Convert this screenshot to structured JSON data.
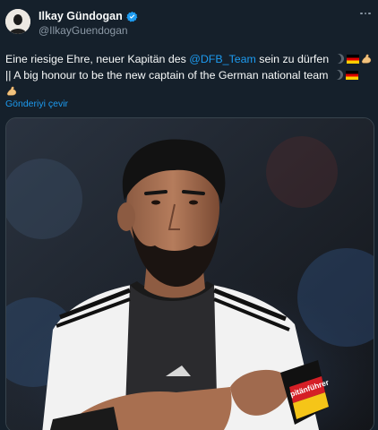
{
  "author": {
    "display_name": "Ilkay Gündogan",
    "handle": "@IlkayGuendogan",
    "verified": true
  },
  "tweet": {
    "line1_pre": "Eine riesige Ehre, neuer Kapitän des ",
    "mention": "@DFB_Team",
    "line1_post": " sein zu dürfen",
    "line2": "|| A big honour to be the new captain of the German national team",
    "translate_label": "Gönderiyi çevir"
  },
  "media": {
    "armband_text": "pitänführer"
  },
  "colors": {
    "background": "#15202b",
    "link": "#1d9bf0",
    "verified": "#1d9bf0",
    "secondary_text": "#8b98a5"
  }
}
